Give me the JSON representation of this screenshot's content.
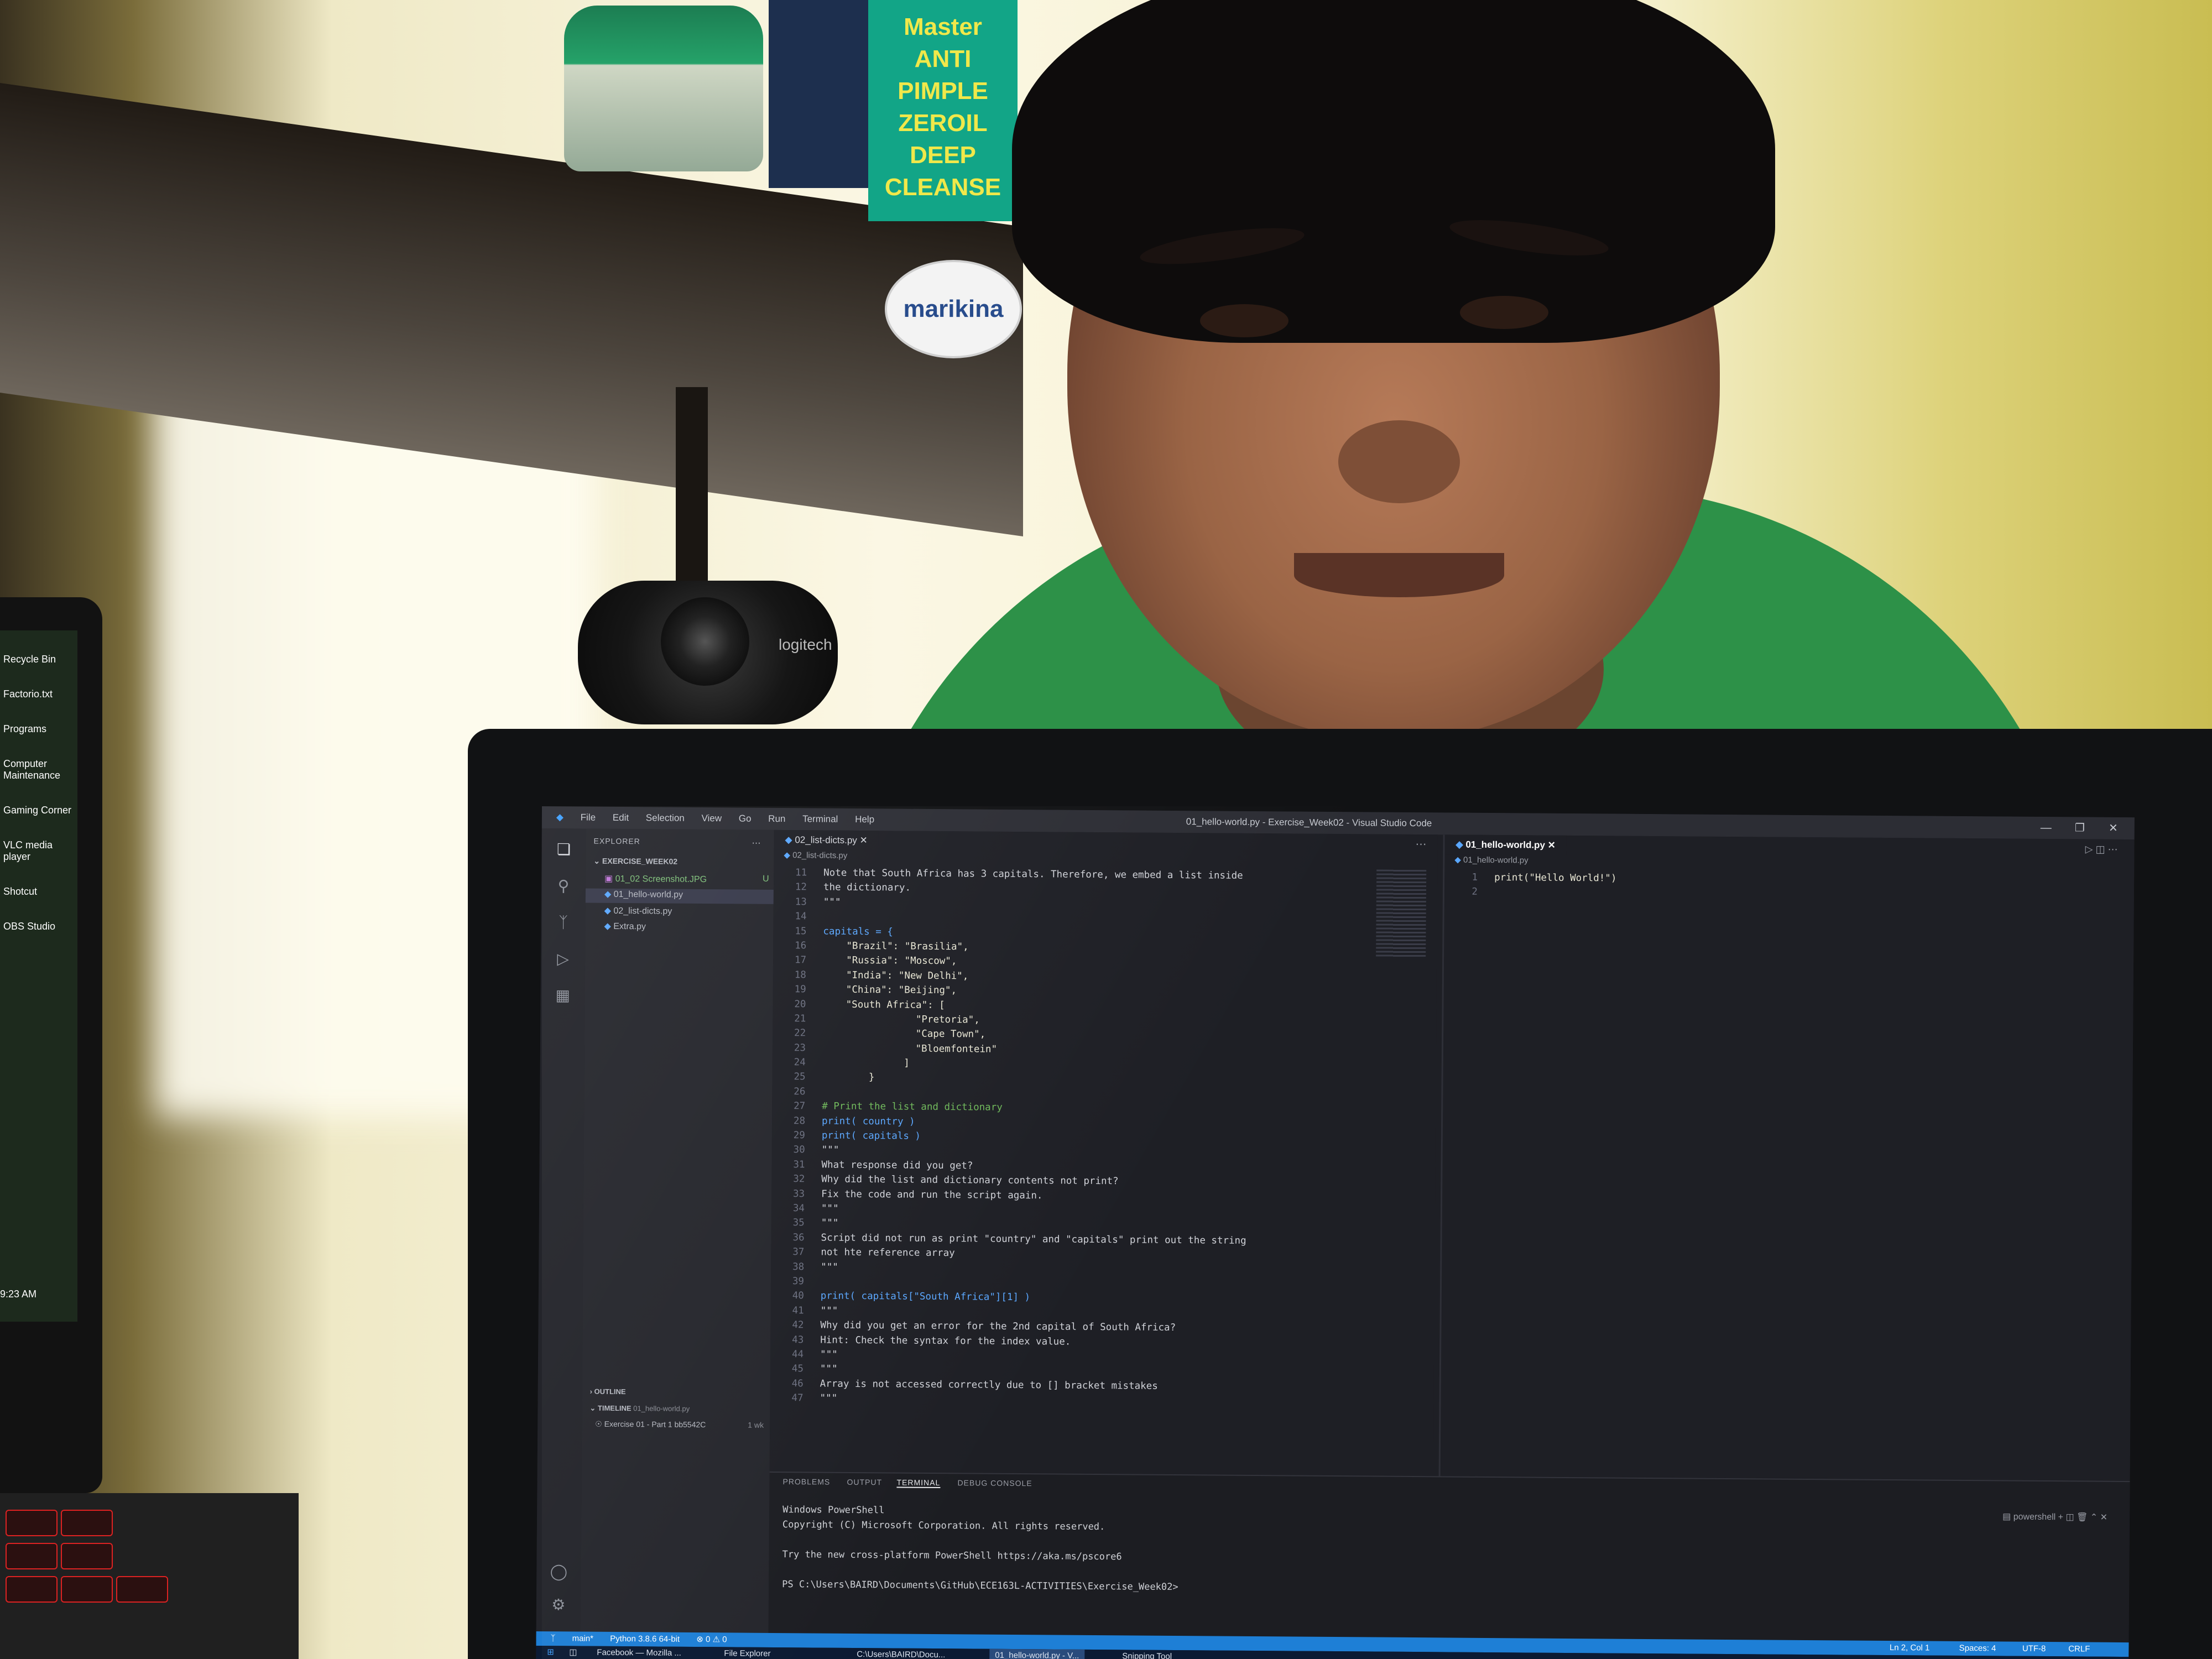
{
  "background": {
    "jar_label": "",
    "box_lines": [
      "Master",
      "ANTI",
      "PIMPLE",
      "ZEROIL",
      "DEEP",
      "CLEANSE"
    ],
    "sticker_text": "marikina",
    "webcam_brand": "logitech",
    "laptop_icons": [
      "Recycle Bin",
      "Factorio.txt",
      "Programs",
      "Computer Maintenance",
      "Gaming Corner",
      "VLC media player",
      "Shotcut",
      "OBS Studio"
    ],
    "laptop_clock": "9:23 AM"
  },
  "vscode": {
    "menu": [
      "File",
      "Edit",
      "Selection",
      "View",
      "Go",
      "Run",
      "Terminal",
      "Help"
    ],
    "window_title": "01_hello-world.py - Exercise_Week02 - Visual Studio Code",
    "explorer": {
      "header": "EXPLORER",
      "folder": "EXERCISE_WEEK02",
      "files": [
        {
          "name": "01_02 Screenshot.JPG",
          "badge": "U"
        },
        {
          "name": "01_hello-world.py",
          "badge": ""
        },
        {
          "name": "02_list-dicts.py",
          "badge": ""
        },
        {
          "name": "Extra.py",
          "badge": ""
        }
      ],
      "outline": "OUTLINE",
      "timeline": "TIMELINE",
      "timeline_file": "01_hello-world.py",
      "timeline_entry": "Exercise 01 - Part 1 bb5542C",
      "timeline_age": "1 wk"
    },
    "editor_left": {
      "tab": "02_list-dicts.py",
      "breadcrumb": "02_list-dicts.py",
      "lines": [
        {
          "n": "11",
          "t": "Note that South Africa has 3 capitals. Therefore, we embed a list inside",
          "c": "tx"
        },
        {
          "n": "12",
          "t": "the dictionary.",
          "c": "tx"
        },
        {
          "n": "13",
          "t": "\"\"\"",
          "c": "tx"
        },
        {
          "n": "14",
          "t": "",
          "c": "tx"
        },
        {
          "n": "15",
          "t": "capitals = {",
          "c": "kw"
        },
        {
          "n": "16",
          "t": "    \"Brazil\": \"Brasilia\",",
          "c": "st"
        },
        {
          "n": "17",
          "t": "    \"Russia\": \"Moscow\",",
          "c": "st"
        },
        {
          "n": "18",
          "t": "    \"India\": \"New Delhi\",",
          "c": "st"
        },
        {
          "n": "19",
          "t": "    \"China\": \"Beijing\",",
          "c": "st"
        },
        {
          "n": "20",
          "t": "    \"South Africa\": [",
          "c": "st"
        },
        {
          "n": "21",
          "t": "                \"Pretoria\",",
          "c": "st"
        },
        {
          "n": "22",
          "t": "                \"Cape Town\",",
          "c": "st"
        },
        {
          "n": "23",
          "t": "                \"Bloemfontein\"",
          "c": "st"
        },
        {
          "n": "24",
          "t": "              ]",
          "c": "st"
        },
        {
          "n": "25",
          "t": "        }",
          "c": "st"
        },
        {
          "n": "26",
          "t": "",
          "c": "tx"
        },
        {
          "n": "27",
          "t": "# Print the list and dictionary",
          "c": "cm"
        },
        {
          "n": "28",
          "t": "print( country )",
          "c": "kw"
        },
        {
          "n": "29",
          "t": "print( capitals )",
          "c": "kw"
        },
        {
          "n": "30",
          "t": "\"\"\"",
          "c": "tx"
        },
        {
          "n": "31",
          "t": "What response did you get?",
          "c": "tx"
        },
        {
          "n": "32",
          "t": "Why did the list and dictionary contents not print?",
          "c": "tx"
        },
        {
          "n": "33",
          "t": "Fix the code and run the script again.",
          "c": "tx"
        },
        {
          "n": "34",
          "t": "\"\"\"",
          "c": "tx"
        },
        {
          "n": "35",
          "t": "\"\"\"",
          "c": "tx"
        },
        {
          "n": "36",
          "t": "Script did not run as print \"country\" and \"capitals\" print out the string",
          "c": "tx"
        },
        {
          "n": "37",
          "t": "not hte reference array",
          "c": "tx"
        },
        {
          "n": "38",
          "t": "\"\"\"",
          "c": "tx"
        },
        {
          "n": "39",
          "t": "",
          "c": "tx"
        },
        {
          "n": "40",
          "t": "print( capitals[\"South Africa\"][1] )",
          "c": "kw"
        },
        {
          "n": "41",
          "t": "\"\"\"",
          "c": "tx"
        },
        {
          "n": "42",
          "t": "Why did you get an error for the 2nd capital of South Africa?",
          "c": "tx"
        },
        {
          "n": "43",
          "t": "Hint: Check the syntax for the index value.",
          "c": "tx"
        },
        {
          "n": "44",
          "t": "\"\"\"",
          "c": "tx"
        },
        {
          "n": "45",
          "t": "\"\"\"",
          "c": "tx"
        },
        {
          "n": "46",
          "t": "Array is not accessed correctly due to [] bracket mistakes",
          "c": "tx"
        },
        {
          "n": "47",
          "t": "\"\"\"",
          "c": "tx"
        }
      ]
    },
    "editor_right": {
      "tab": "01_hello-world.py",
      "breadcrumb": "01_hello-world.py",
      "lines": [
        {
          "n": "1",
          "t": "print(\"Hello World!\")",
          "c": "st"
        },
        {
          "n": "2",
          "t": "",
          "c": "tx"
        }
      ]
    },
    "panel": {
      "tabs": [
        "PROBLEMS",
        "OUTPUT",
        "TERMINAL",
        "DEBUG CONSOLE"
      ],
      "active_tab": "TERMINAL",
      "shell": "powershell",
      "terminal_lines": [
        "Windows PowerShell",
        "Copyright (C) Microsoft Corporation. All rights reserved.",
        "",
        "Try the new cross-platform PowerShell https://aka.ms/pscore6",
        "",
        "PS C:\\Users\\BAIRD\\Documents\\GitHub\\ECE163L-ACTIVITIES\\Exercise_Week02>"
      ]
    },
    "statusbar": {
      "branch": "main*",
      "python": "Python 3.8.6 64-bit",
      "problems": "⊗ 0 ⚠ 0",
      "cursor": "Ln 2, Col 1",
      "spaces": "Spaces: 4",
      "encoding": "UTF-8",
      "eol": "CRLF"
    },
    "taskbar": {
      "items": [
        "Facebook — Mozilla ...",
        "File Explorer",
        "C:\\Users\\BAIRD\\Docu...",
        "01_hello-world.py - V...",
        "Snipping Tool"
      ],
      "active_index": 3
    }
  }
}
